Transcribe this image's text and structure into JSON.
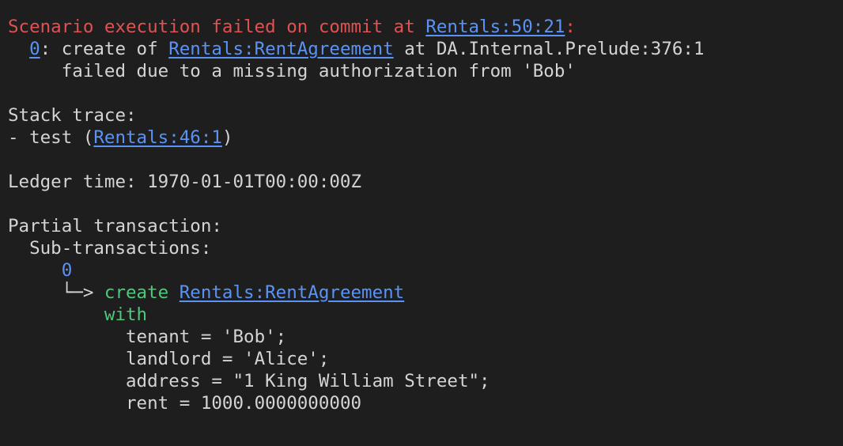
{
  "error": {
    "headline": "Scenario execution failed on commit at ",
    "headline_link": "Rentals:50:21",
    "headline_suffix": ":",
    "node_link": "0",
    "node_sep": ": create of ",
    "template_link": "Rentals:RentAgreement",
    "location": " at DA.Internal.Prelude:376:1",
    "reason": "failed due to a missing authorization from 'Bob'"
  },
  "stack_trace": {
    "header": "Stack trace:",
    "entry_prefix": "- test (",
    "entry_link": "Rentals:46:1",
    "entry_suffix": ")"
  },
  "ledger_time": {
    "text": "Ledger time: 1970-01-01T00:00:00Z"
  },
  "partial_transaction": {
    "header": "Partial transaction:",
    "sub_header": "Sub-transactions:",
    "node_id": "0",
    "arrow": "└─>",
    "create_keyword": "create",
    "template_link": "Rentals:RentAgreement",
    "with_keyword": "with",
    "fields": [
      "tenant = 'Bob';",
      "landlord = 'Alice';",
      "address = \"1 King William Street\";",
      "rent = 1000.0000000000"
    ]
  },
  "colors": {
    "background": "#1e1e1e",
    "error": "#e05252",
    "link": "#5b93f5",
    "keyword": "#4ec97a",
    "text": "#d4d4d4"
  }
}
